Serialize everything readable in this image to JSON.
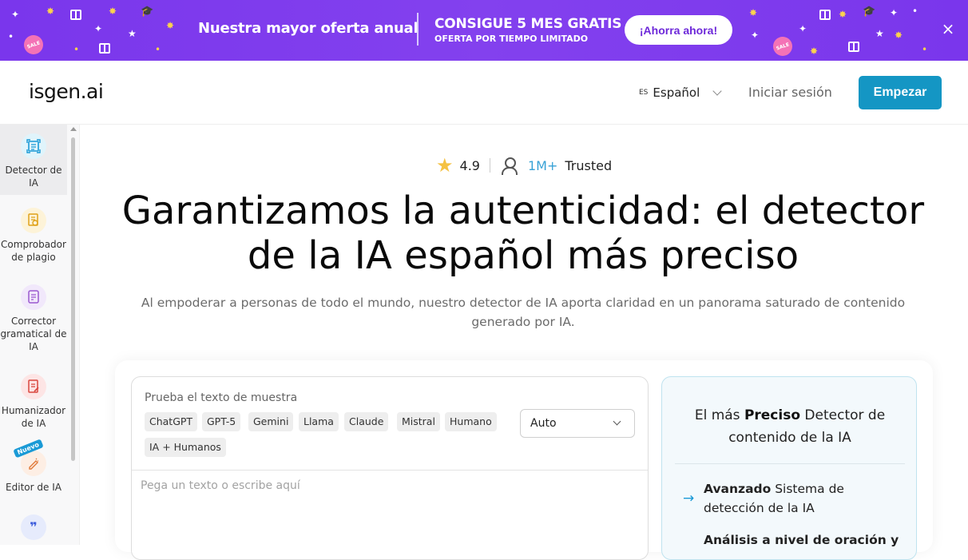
{
  "banner": {
    "title": "Nuestra mayor oferta anual",
    "offer_main": "CONSIGUE 5 MES GRATIS",
    "offer_sub": "OFERTA POR TIEMPO LIMITADO",
    "cta": "¡Ahorra ahora!",
    "close": "×",
    "sale_badge": "SALE",
    "colors": {
      "background": "#7c3aed",
      "cta_text": "#6d28d9"
    }
  },
  "header": {
    "logo": "isgen.ai",
    "language_code": "ES",
    "language": "Español",
    "login": "Iniciar sesión",
    "start": "Empezar",
    "accent": "#1496c4"
  },
  "sidebar": {
    "items": [
      {
        "label": "Detector de IA",
        "icon": "ai-detector-icon",
        "active": true
      },
      {
        "label": "Comprobador de plagio",
        "icon": "plagiarism-icon"
      },
      {
        "label": "Corrector gramatical de IA",
        "icon": "grammar-icon"
      },
      {
        "label": "Humanizador de IA",
        "icon": "humanizer-icon"
      },
      {
        "label": "Editor de IA",
        "icon": "editor-icon",
        "badge": "Nuevo"
      },
      {
        "label": "",
        "icon": "quote-icon"
      }
    ]
  },
  "hero": {
    "rating": "4.9",
    "trusted_count": "1M+",
    "trusted_label": "Trusted",
    "title": "Garantizamos la autenticidad: el detector de la IA español más preciso",
    "subtitle": "Al empoderar a personas de todo el mundo, nuestro detector de IA aporta claridad en un panorama saturado de contenido generado por IA."
  },
  "detector": {
    "sample_label": "Prueba el texto de muestra",
    "chips": [
      "ChatGPT",
      "GPT-5",
      "Gemini",
      "Llama",
      "Claude",
      "Mistral",
      "Humano",
      "IA + Humanos"
    ],
    "model_select": "Auto",
    "placeholder": "Pega un texto o escribe aquí"
  },
  "info": {
    "title_pre": "El más ",
    "title_bold": "Preciso",
    "title_post": " Detector de contenido de la IA",
    "feature1_bold": "Avanzado",
    "feature1_rest": " Sistema de detección de la IA",
    "feature2": "Análisis a nivel de oración y"
  }
}
